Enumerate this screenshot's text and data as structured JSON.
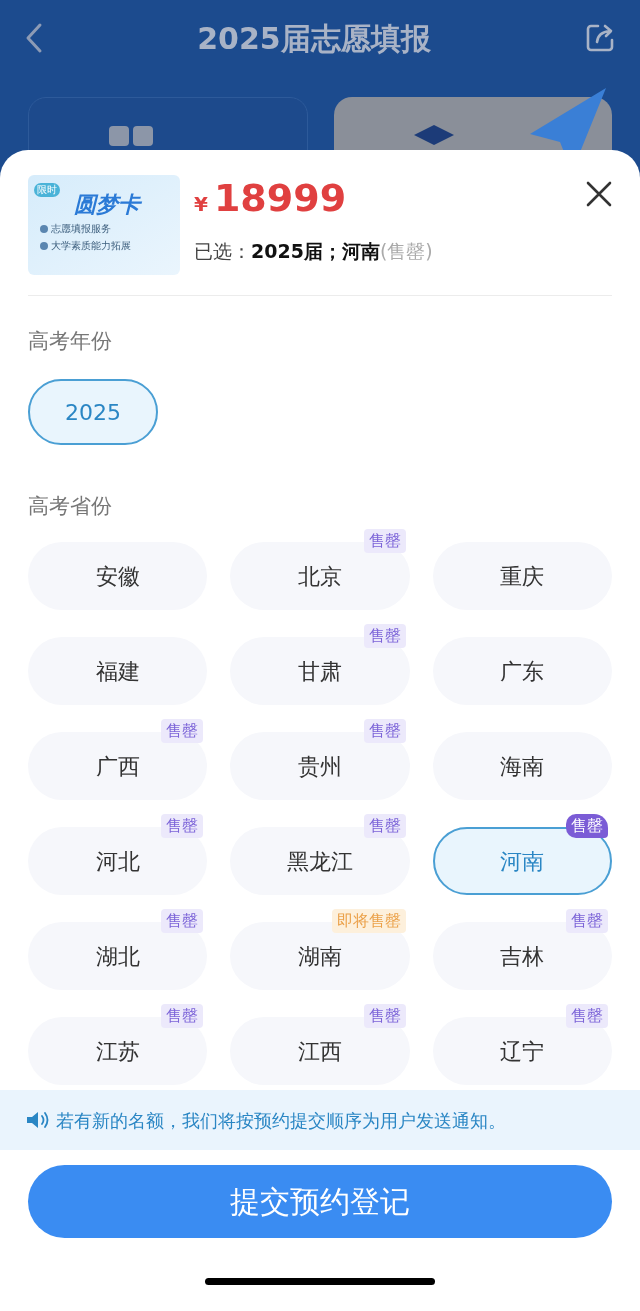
{
  "header": {
    "title": "2025届志愿填报"
  },
  "plan_cards": [
    {
      "selected": false
    },
    {
      "selected": true
    }
  ],
  "product": {
    "badge": "限时",
    "name": "圆梦卡",
    "features": [
      "志愿填报服务",
      "大学素质能力拓展"
    ],
    "currency": "¥",
    "price": "18999",
    "selected_label": "已选：",
    "selected_value": "2025届；河南",
    "selected_note": "(售罄)"
  },
  "year_section": {
    "label": "高考年份",
    "options": [
      {
        "label": "2025",
        "selected": true
      }
    ]
  },
  "province_section": {
    "label": "高考省份",
    "options": [
      {
        "name": "安徽",
        "selected": false
      },
      {
        "name": "北京",
        "selected": false,
        "tag": {
          "kind": "sold_out",
          "text": "售罄"
        }
      },
      {
        "name": "重庆",
        "selected": false
      },
      {
        "name": "福建",
        "selected": false
      },
      {
        "name": "甘肃",
        "selected": false,
        "tag": {
          "kind": "sold_out",
          "text": "售罄"
        }
      },
      {
        "name": "广东",
        "selected": false
      },
      {
        "name": "广西",
        "selected": false,
        "tag": {
          "kind": "sold_out",
          "text": "售罄"
        }
      },
      {
        "name": "贵州",
        "selected": false,
        "tag": {
          "kind": "sold_out",
          "text": "售罄"
        }
      },
      {
        "name": "海南",
        "selected": false
      },
      {
        "name": "河北",
        "selected": false,
        "tag": {
          "kind": "sold_out",
          "text": "售罄"
        }
      },
      {
        "name": "黑龙江",
        "selected": false,
        "tag": {
          "kind": "sold_out",
          "text": "售罄"
        }
      },
      {
        "name": "河南",
        "selected": true,
        "tag": {
          "kind": "sold_out",
          "text": "售罄"
        }
      },
      {
        "name": "湖北",
        "selected": false,
        "tag": {
          "kind": "sold_out",
          "text": "售罄"
        }
      },
      {
        "name": "湖南",
        "selected": false,
        "tag": {
          "kind": "soon",
          "text": "即将售罄"
        }
      },
      {
        "name": "吉林",
        "selected": false,
        "tag": {
          "kind": "sold_out",
          "text": "售罄"
        }
      },
      {
        "name": "江苏",
        "selected": false,
        "tag": {
          "kind": "sold_out",
          "text": "售罄"
        }
      },
      {
        "name": "江西",
        "selected": false,
        "tag": {
          "kind": "sold_out",
          "text": "售罄"
        }
      },
      {
        "name": "辽宁",
        "selected": false,
        "tag": {
          "kind": "sold_out",
          "text": "售罄"
        }
      }
    ]
  },
  "notice": "若有新的名额，我们将按预约提交顺序为用户发送通知。",
  "submit_button": "提交预约登记"
}
